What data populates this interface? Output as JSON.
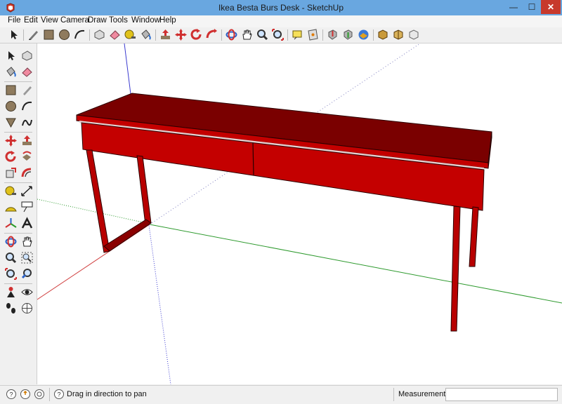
{
  "window": {
    "title": "Ikea Besta Burs Desk - SketchUp",
    "minimize_glyph": "—",
    "maximize_glyph": "☐",
    "close_glyph": "✕"
  },
  "menu": {
    "items": [
      "File",
      "Edit",
      "View",
      "Camera",
      "Draw",
      "Tools",
      "Window",
      "Help"
    ]
  },
  "toolbar": {
    "icons": [
      "select-icon",
      "eraser-icon",
      "rectangle-icon",
      "circle-icon",
      "arc-icon",
      "make-component-icon",
      "paint-bucket-icon",
      "push-pull-icon",
      "tape-measure-icon",
      "move-icon",
      "rotate-icon",
      "follow-me-icon",
      "orbit-icon",
      "pan-icon",
      "zoom-icon",
      "zoom-extents-icon",
      "text-icon",
      "section-plane-icon",
      "get-models-icon",
      "share-model-icon",
      "3d-warehouse-icon",
      "extension-icon",
      "components-icon",
      "styles-icon"
    ]
  },
  "left_toolbar": {
    "icons": [
      "select-icon",
      "make-component-icon",
      "paint-bucket-icon",
      "eraser-icon",
      "rectangle-icon",
      "line-icon",
      "circle-icon",
      "arc-icon",
      "polygon-icon",
      "freehand-icon",
      "move-icon",
      "push-pull-icon",
      "rotate-icon",
      "follow-me-icon",
      "scale-icon",
      "offset-icon",
      "tape-measure-icon",
      "dimension-icon",
      "protractor-icon",
      "text-icon",
      "axes-icon",
      "3d-text-icon",
      "orbit-icon",
      "pan-icon",
      "zoom-icon",
      "zoom-window-icon",
      "zoom-extents-icon",
      "previous-view-icon",
      "position-camera-icon",
      "look-around-icon",
      "walk-icon",
      "section-plane-icon"
    ]
  },
  "status": {
    "message": "Drag in direction to pan",
    "measurements_label": "Measurements",
    "measurements_value": ""
  },
  "colors": {
    "model_top": "#7a0000",
    "model_front": "#c40000",
    "model_front_dark": "#a30000",
    "axis_red": "#d04040",
    "axis_green": "#2e9a2e",
    "axis_blue": "#3a3ad0"
  }
}
